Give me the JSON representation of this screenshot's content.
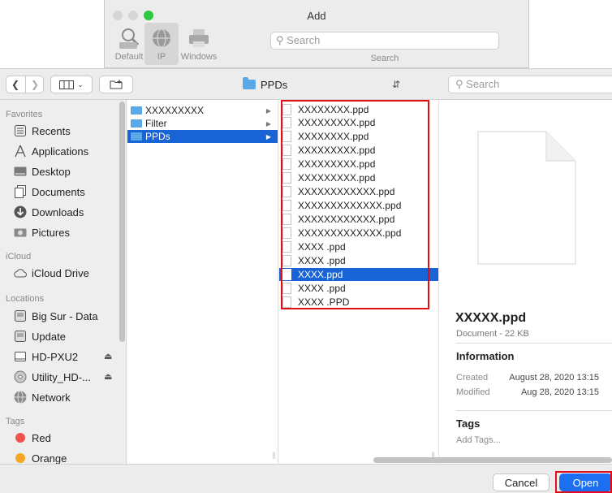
{
  "back_window": {
    "title": "Add",
    "tools": [
      {
        "label": "Default",
        "icon": "default-printer-icon"
      },
      {
        "label": "IP",
        "icon": "globe-icon"
      },
      {
        "label": "Windows",
        "icon": "printer-icon"
      }
    ],
    "search_placeholder": "Search",
    "search_caption": "Search"
  },
  "toolbar": {
    "path_label": "PPDs",
    "search_placeholder": "Search"
  },
  "sidebar": {
    "favorites_header": "Favorites",
    "favorites": [
      {
        "label": "Recents",
        "icon": "recents-icon"
      },
      {
        "label": "Applications",
        "icon": "applications-icon"
      },
      {
        "label": "Desktop",
        "icon": "desktop-icon"
      },
      {
        "label": "Documents",
        "icon": "documents-icon"
      },
      {
        "label": "Downloads",
        "icon": "downloads-icon"
      },
      {
        "label": "Pictures",
        "icon": "pictures-icon"
      }
    ],
    "icloud_header": "iCloud",
    "icloud": [
      {
        "label": "iCloud Drive",
        "icon": "cloud-icon"
      }
    ],
    "locations_header": "Locations",
    "locations": [
      {
        "label": "Big Sur - Data",
        "icon": "disk-icon"
      },
      {
        "label": "Update",
        "icon": "disk-icon"
      },
      {
        "label": "HD-PXU2",
        "icon": "external-drive-icon"
      },
      {
        "label": "Utility_HD-...",
        "icon": "optical-disk-icon"
      },
      {
        "label": "Network",
        "icon": "network-icon"
      }
    ],
    "tags_header": "Tags",
    "tags": [
      {
        "label": "Red",
        "color": "#f0524e"
      },
      {
        "label": "Orange",
        "color": "#f5a623"
      }
    ]
  },
  "column1": [
    {
      "label": "XXXXXXXXX",
      "has_children": true,
      "selected": false
    },
    {
      "label": "Filter",
      "has_children": true,
      "selected": false
    },
    {
      "label": "PPDs",
      "has_children": true,
      "selected": true
    }
  ],
  "column2": [
    {
      "label": "XXXXXXXX.ppd",
      "selected": false
    },
    {
      "label": "XXXXXXXXX.ppd",
      "selected": false
    },
    {
      "label": "XXXXXXXX.ppd",
      "selected": false
    },
    {
      "label": "XXXXXXXXX.ppd",
      "selected": false
    },
    {
      "label": "XXXXXXXXX.ppd",
      "selected": false
    },
    {
      "label": "XXXXXXXXX.ppd",
      "selected": false
    },
    {
      "label": "XXXXXXXXXXXX.ppd",
      "selected": false
    },
    {
      "label": "XXXXXXXXXXXXX.ppd",
      "selected": false
    },
    {
      "label": "XXXXXXXXXXXX.ppd",
      "selected": false
    },
    {
      "label": "XXXXXXXXXXXXX.ppd",
      "selected": false
    },
    {
      "label": "XXXX .ppd",
      "selected": false
    },
    {
      "label": "XXXX .ppd",
      "selected": false
    },
    {
      "label": "XXXX.ppd",
      "selected": true
    },
    {
      "label": "XXXX .ppd",
      "selected": false
    },
    {
      "label": "XXXX .PPD",
      "selected": false
    }
  ],
  "preview": {
    "file_name": "XXXXX.ppd",
    "kind_size": "Document - 22 KB",
    "information_header": "Information",
    "created_label": "Created",
    "created_value": "August 28, 2020 13:15",
    "modified_label": "Modified",
    "modified_value": "Aug 28, 2020 13:15",
    "tags_header": "Tags",
    "tags_placeholder": "Add Tags..."
  },
  "buttons": {
    "cancel": "Cancel",
    "open": "Open"
  },
  "colors": {
    "selection": "#1863d6",
    "highlight_box": "#e30d17",
    "primary_button": "#1c6ff0"
  }
}
